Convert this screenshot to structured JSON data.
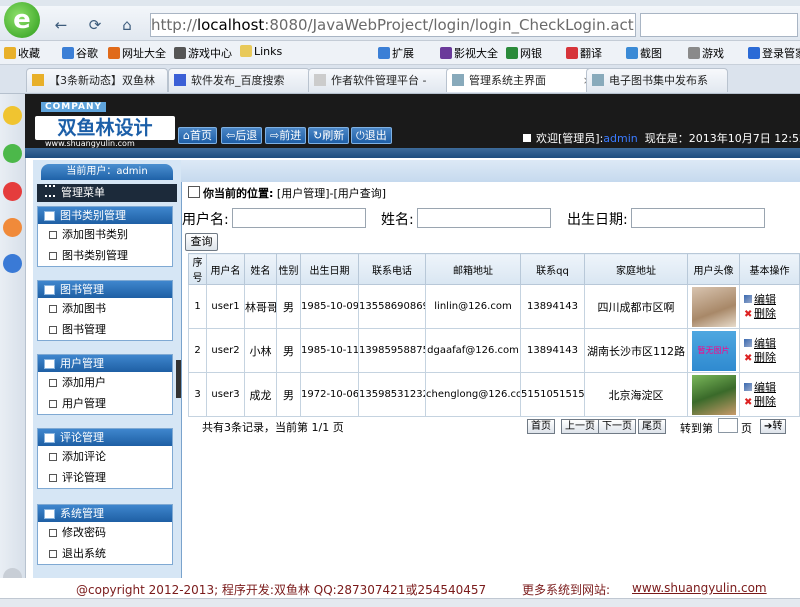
{
  "browser": {
    "url_prefix": "http://",
    "url_host": "localhost",
    "url_rest": ":8080/JavaWebProject/login/login_CheckLogin.acti",
    "bookmarks": [
      "收藏",
      "谷歌",
      "网址大全",
      "游戏中心",
      "Links",
      "扩展",
      "影视大全",
      "网银",
      "翻译",
      "截图",
      "游戏",
      "登录管家"
    ],
    "tabs": [
      "【3条新动态】双鱼林",
      "软件发布_百度搜索",
      "作者软件管理平台 -",
      "管理系统主界面",
      "电子图书集中发布系"
    ]
  },
  "header": {
    "company": "COMPANY",
    "brand": "双鱼林设计",
    "brand_url": "www.shuangyulin.com",
    "buttons": [
      "首页",
      "后退",
      "前进",
      "刷新",
      "退出"
    ],
    "welcome_prefix": "欢迎[管理员]:",
    "welcome_user": "admin",
    "time_label": "现在是：2013年10月7日  12:52:46"
  },
  "sidebar": {
    "current_user": "当前用户：admin",
    "menu_title": "管理菜单",
    "groups": [
      {
        "title": "图书类别管理",
        "items": [
          "添加图书类别",
          "图书类别管理"
        ]
      },
      {
        "title": "图书管理",
        "items": [
          "添加图书",
          "图书管理"
        ]
      },
      {
        "title": "用户管理",
        "items": [
          "添加用户",
          "用户管理"
        ]
      },
      {
        "title": "评论管理",
        "items": [
          "添加评论",
          "评论管理"
        ]
      },
      {
        "title": "系统管理",
        "items": [
          "修改密码",
          "退出系统"
        ]
      }
    ]
  },
  "main": {
    "breadcrumb_label": "你当前的位置:",
    "breadcrumb_path": "[用户管理]-[用户查询]",
    "search": {
      "username_label": "用户名:",
      "name_label": "姓名:",
      "birth_label": "出生日期:",
      "query_button": "查询"
    },
    "columns": [
      "序号",
      "用户名",
      "姓名",
      "性别",
      "出生日期",
      "联系电话",
      "邮箱地址",
      "联系qq",
      "家庭地址",
      "用户头像",
      "基本操作"
    ],
    "rows": [
      {
        "no": "1",
        "username": "user1",
        "name": "林哥哥",
        "gender": "男",
        "birth": "1985-10-09",
        "phone": "13558690869",
        "email": "linlin@126.com",
        "qq": "13894143",
        "address": "四川成都市区啊",
        "avatar": "photo"
      },
      {
        "no": "2",
        "username": "user2",
        "name": "小林",
        "gender": "男",
        "birth": "1985-10-11",
        "phone": "13985958875",
        "email": "dgaafaf@126.com",
        "qq": "13894143",
        "address": "湖南长沙市区112路",
        "avatar": "暂无图片"
      },
      {
        "no": "3",
        "username": "user3",
        "name": "成龙",
        "gender": "男",
        "birth": "1972-10-06",
        "phone": "13598531232",
        "email": "chenglong@126.com",
        "qq": "5151051515",
        "address": "北京海淀区",
        "avatar": "photo"
      }
    ],
    "ops": {
      "edit": "编辑",
      "delete": "删除"
    },
    "pager": {
      "summary": "共有3条记录，当前第 1/1 页",
      "first": "首页",
      "prev": "上一页",
      "next": "下一页",
      "last": "尾页",
      "goto_label": "转到第",
      "page_unit": "页",
      "go_button": "转"
    }
  },
  "footer": {
    "copyright": "@copyright 2012-2013; 程序开发:双鱼林  QQ:287307421或254540457",
    "more": "更多系统到网站:",
    "site": "www.shuangyulin.com"
  },
  "colors": {
    "header_bg": "#1a1a1a",
    "nav_blue": "#1e5fa4",
    "sidebar_bg": "#d6e6f5",
    "footer_text": "#7a1a1a"
  }
}
